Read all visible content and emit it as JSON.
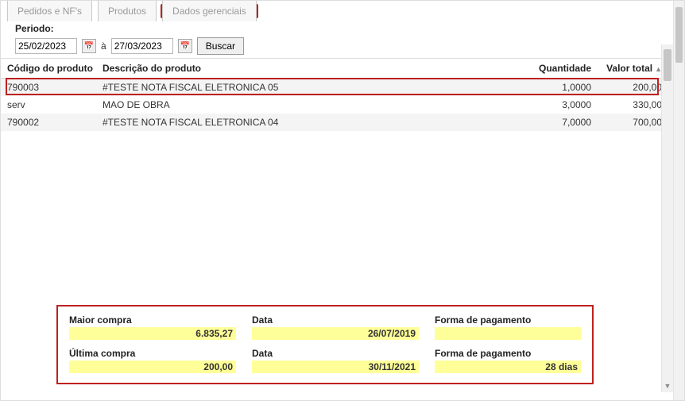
{
  "tabs": [
    {
      "label": "Pedidos e NF's"
    },
    {
      "label": "Produtos"
    },
    {
      "label": "Dados gerenciais"
    }
  ],
  "period": {
    "label": "Periodo:",
    "from": "25/02/2023",
    "sep": "à",
    "to": "27/03/2023",
    "search": "Buscar"
  },
  "grid": {
    "headers": {
      "code": "Código do produto",
      "desc": "Descrição do produto",
      "qty": "Quantidade",
      "val": "Valor total"
    },
    "rows": [
      {
        "code": "790003",
        "desc": "#TESTE NOTA FISCAL ELETRONICA 05",
        "qty": "1,0000",
        "val": "200,00"
      },
      {
        "code": "serv",
        "desc": "MAO DE OBRA",
        "qty": "3,0000",
        "val": "330,00"
      },
      {
        "code": "790002",
        "desc": "#TESTE NOTA FISCAL ELETRONICA 04",
        "qty": "7,0000",
        "val": "700,00"
      }
    ]
  },
  "bottom": {
    "maior_compra": {
      "label": "Maior compra",
      "value": "6.835,27"
    },
    "maior_data": {
      "label": "Data",
      "value": "26/07/2019"
    },
    "maior_forma": {
      "label": "Forma de pagamento",
      "value": ""
    },
    "ultima_compra": {
      "label": "Última compra",
      "value": "200,00"
    },
    "ultima_data": {
      "label": "Data",
      "value": "30/11/2021"
    },
    "ultima_forma": {
      "label": "Forma de pagamento",
      "value": "28 dias"
    }
  }
}
